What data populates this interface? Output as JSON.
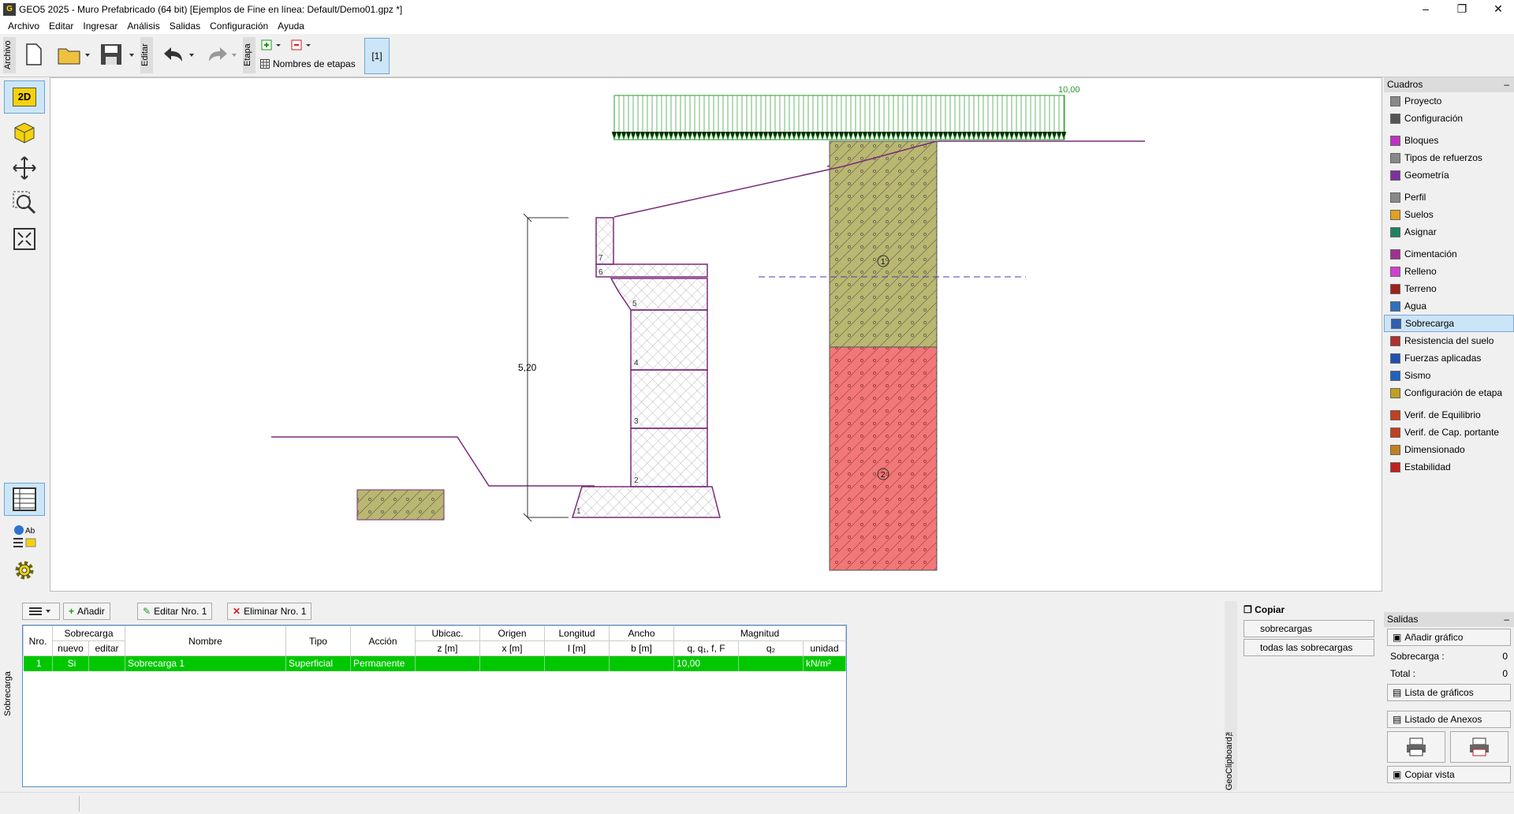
{
  "window": {
    "title": "GEO5 2025 - Muro Prefabricado (64 bit) [Ejemplos de Fine en línea: Default/Demo01.gpz *]"
  },
  "menu": [
    "Archivo",
    "Editar",
    "Ingresar",
    "Análisis",
    "Salidas",
    "Configuración",
    "Ayuda"
  ],
  "toolbar": {
    "archivo_label": "Archivo",
    "editar_label": "Editar",
    "etapa_label": "Etapa",
    "stage_names": "Nombres de etapas",
    "stage_current": "[1]"
  },
  "lefttools": {
    "view2d": "2D"
  },
  "drawing": {
    "surcharge_value": "10,00",
    "height_dim": "5,20",
    "soil_1": "1",
    "soil_2": "2",
    "blocks": [
      "1",
      "2",
      "3",
      "4",
      "5",
      "6",
      "7"
    ]
  },
  "rightpanel": {
    "title": "Cuadros",
    "items": [
      {
        "label": "Proyecto",
        "color": "#888"
      },
      {
        "label": "Configuración",
        "color": "#555"
      },
      {
        "label": "Bloques",
        "color": "#c030c0"
      },
      {
        "label": "Tipos de refuerzos",
        "color": "#888"
      },
      {
        "label": "Geometría",
        "color": "#8030a0"
      },
      {
        "label": "Perfil",
        "color": "#888"
      },
      {
        "label": "Suelos",
        "color": "#e0a020"
      },
      {
        "label": "Asignar",
        "color": "#208060"
      },
      {
        "label": "Cimentación",
        "color": "#a03090"
      },
      {
        "label": "Relleno",
        "color": "#d040d0"
      },
      {
        "label": "Terreno",
        "color": "#a02020"
      },
      {
        "label": "Agua",
        "color": "#3070c0"
      },
      {
        "label": "Sobrecarga",
        "color": "#3060b0"
      },
      {
        "label": "Resistencia del suelo",
        "color": "#b03030"
      },
      {
        "label": "Fuerzas aplicadas",
        "color": "#2050b0"
      },
      {
        "label": "Sismo",
        "color": "#2060c0"
      },
      {
        "label": "Configuración de etapa",
        "color": "#c0a020"
      },
      {
        "label": "Verif. de Equilibrio",
        "color": "#c04020"
      },
      {
        "label": "Verif. de Cap. portante",
        "color": "#c04020"
      },
      {
        "label": "Dimensionado",
        "color": "#c08020"
      },
      {
        "label": "Estabilidad",
        "color": "#c02020"
      }
    ],
    "outputs_title": "Salidas",
    "add_graphic": "Añadir gráfico",
    "surcharge_label": "Sobrecarga :",
    "surcharge_count": "0",
    "total_label": "Total :",
    "total_count": "0",
    "graphics_list": "Lista de gráficos",
    "annex_list": "Listado de Anexos",
    "copy_view": "Copiar vista"
  },
  "bottom": {
    "side_label": "Sobrecarga",
    "add": "Añadir",
    "edit": "Editar Nro. 1",
    "delete": "Eliminar Nro. 1",
    "headers1": [
      "Nro.",
      "Sobrecarga",
      "Nombre",
      "Tipo",
      "Acción",
      "Ubicac.",
      "Origen",
      "Longitud",
      "Ancho",
      "Magnitud"
    ],
    "headers2": [
      "nuevo",
      "editar",
      "z [m]",
      "x [m]",
      "l [m]",
      "b [m]",
      "q, q₁, f, F",
      "q₂",
      "unidad"
    ],
    "row": {
      "nro": "1",
      "nuevo": "Si",
      "editar": "",
      "nombre": "Sobrecarga 1",
      "tipo": "Superficial",
      "accion": "Permanente",
      "z": "",
      "x": "",
      "l": "",
      "b": "",
      "q": "10,00",
      "q2": "",
      "unidad": "kN/m²"
    }
  },
  "clipboard": {
    "copy": "Copiar",
    "selected": "sobrecargas seleccionadas",
    "all": "todas las sobrecargas",
    "side": "GeoClipboard™"
  }
}
